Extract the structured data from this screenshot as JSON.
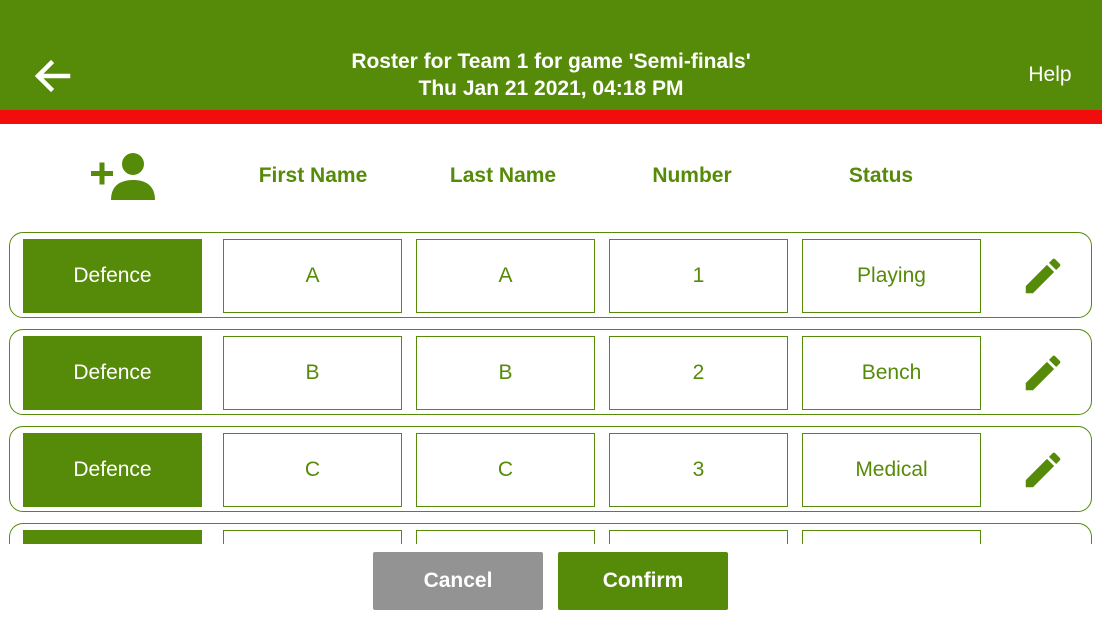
{
  "header": {
    "title_line1": "Roster for Team 1 for game 'Semi-finals'",
    "title_line2": "Thu Jan 21 2021, 04:18 PM",
    "help_label": "Help",
    "back_icon": "arrow-left-icon"
  },
  "colors": {
    "primary_green": "#568a09",
    "accent_red": "#f20d0d",
    "cancel_gray": "#939393"
  },
  "columns": {
    "add_icon": "add-person-icon",
    "first_name": "First Name",
    "last_name": "Last Name",
    "number": "Number",
    "status": "Status"
  },
  "roster": [
    {
      "position": "Defence",
      "first_name": "A",
      "last_name": "A",
      "number": "1",
      "status": "Playing",
      "edit_icon": "pencil-icon"
    },
    {
      "position": "Defence",
      "first_name": "B",
      "last_name": "B",
      "number": "2",
      "status": "Bench",
      "edit_icon": "pencil-icon"
    },
    {
      "position": "Defence",
      "first_name": "C",
      "last_name": "C",
      "number": "3",
      "status": "Medical",
      "edit_icon": "pencil-icon"
    },
    {
      "position": "",
      "first_name": "",
      "last_name": "",
      "number": "",
      "status": "",
      "edit_icon": "pencil-icon"
    }
  ],
  "footer": {
    "cancel_label": "Cancel",
    "confirm_label": "Confirm"
  }
}
